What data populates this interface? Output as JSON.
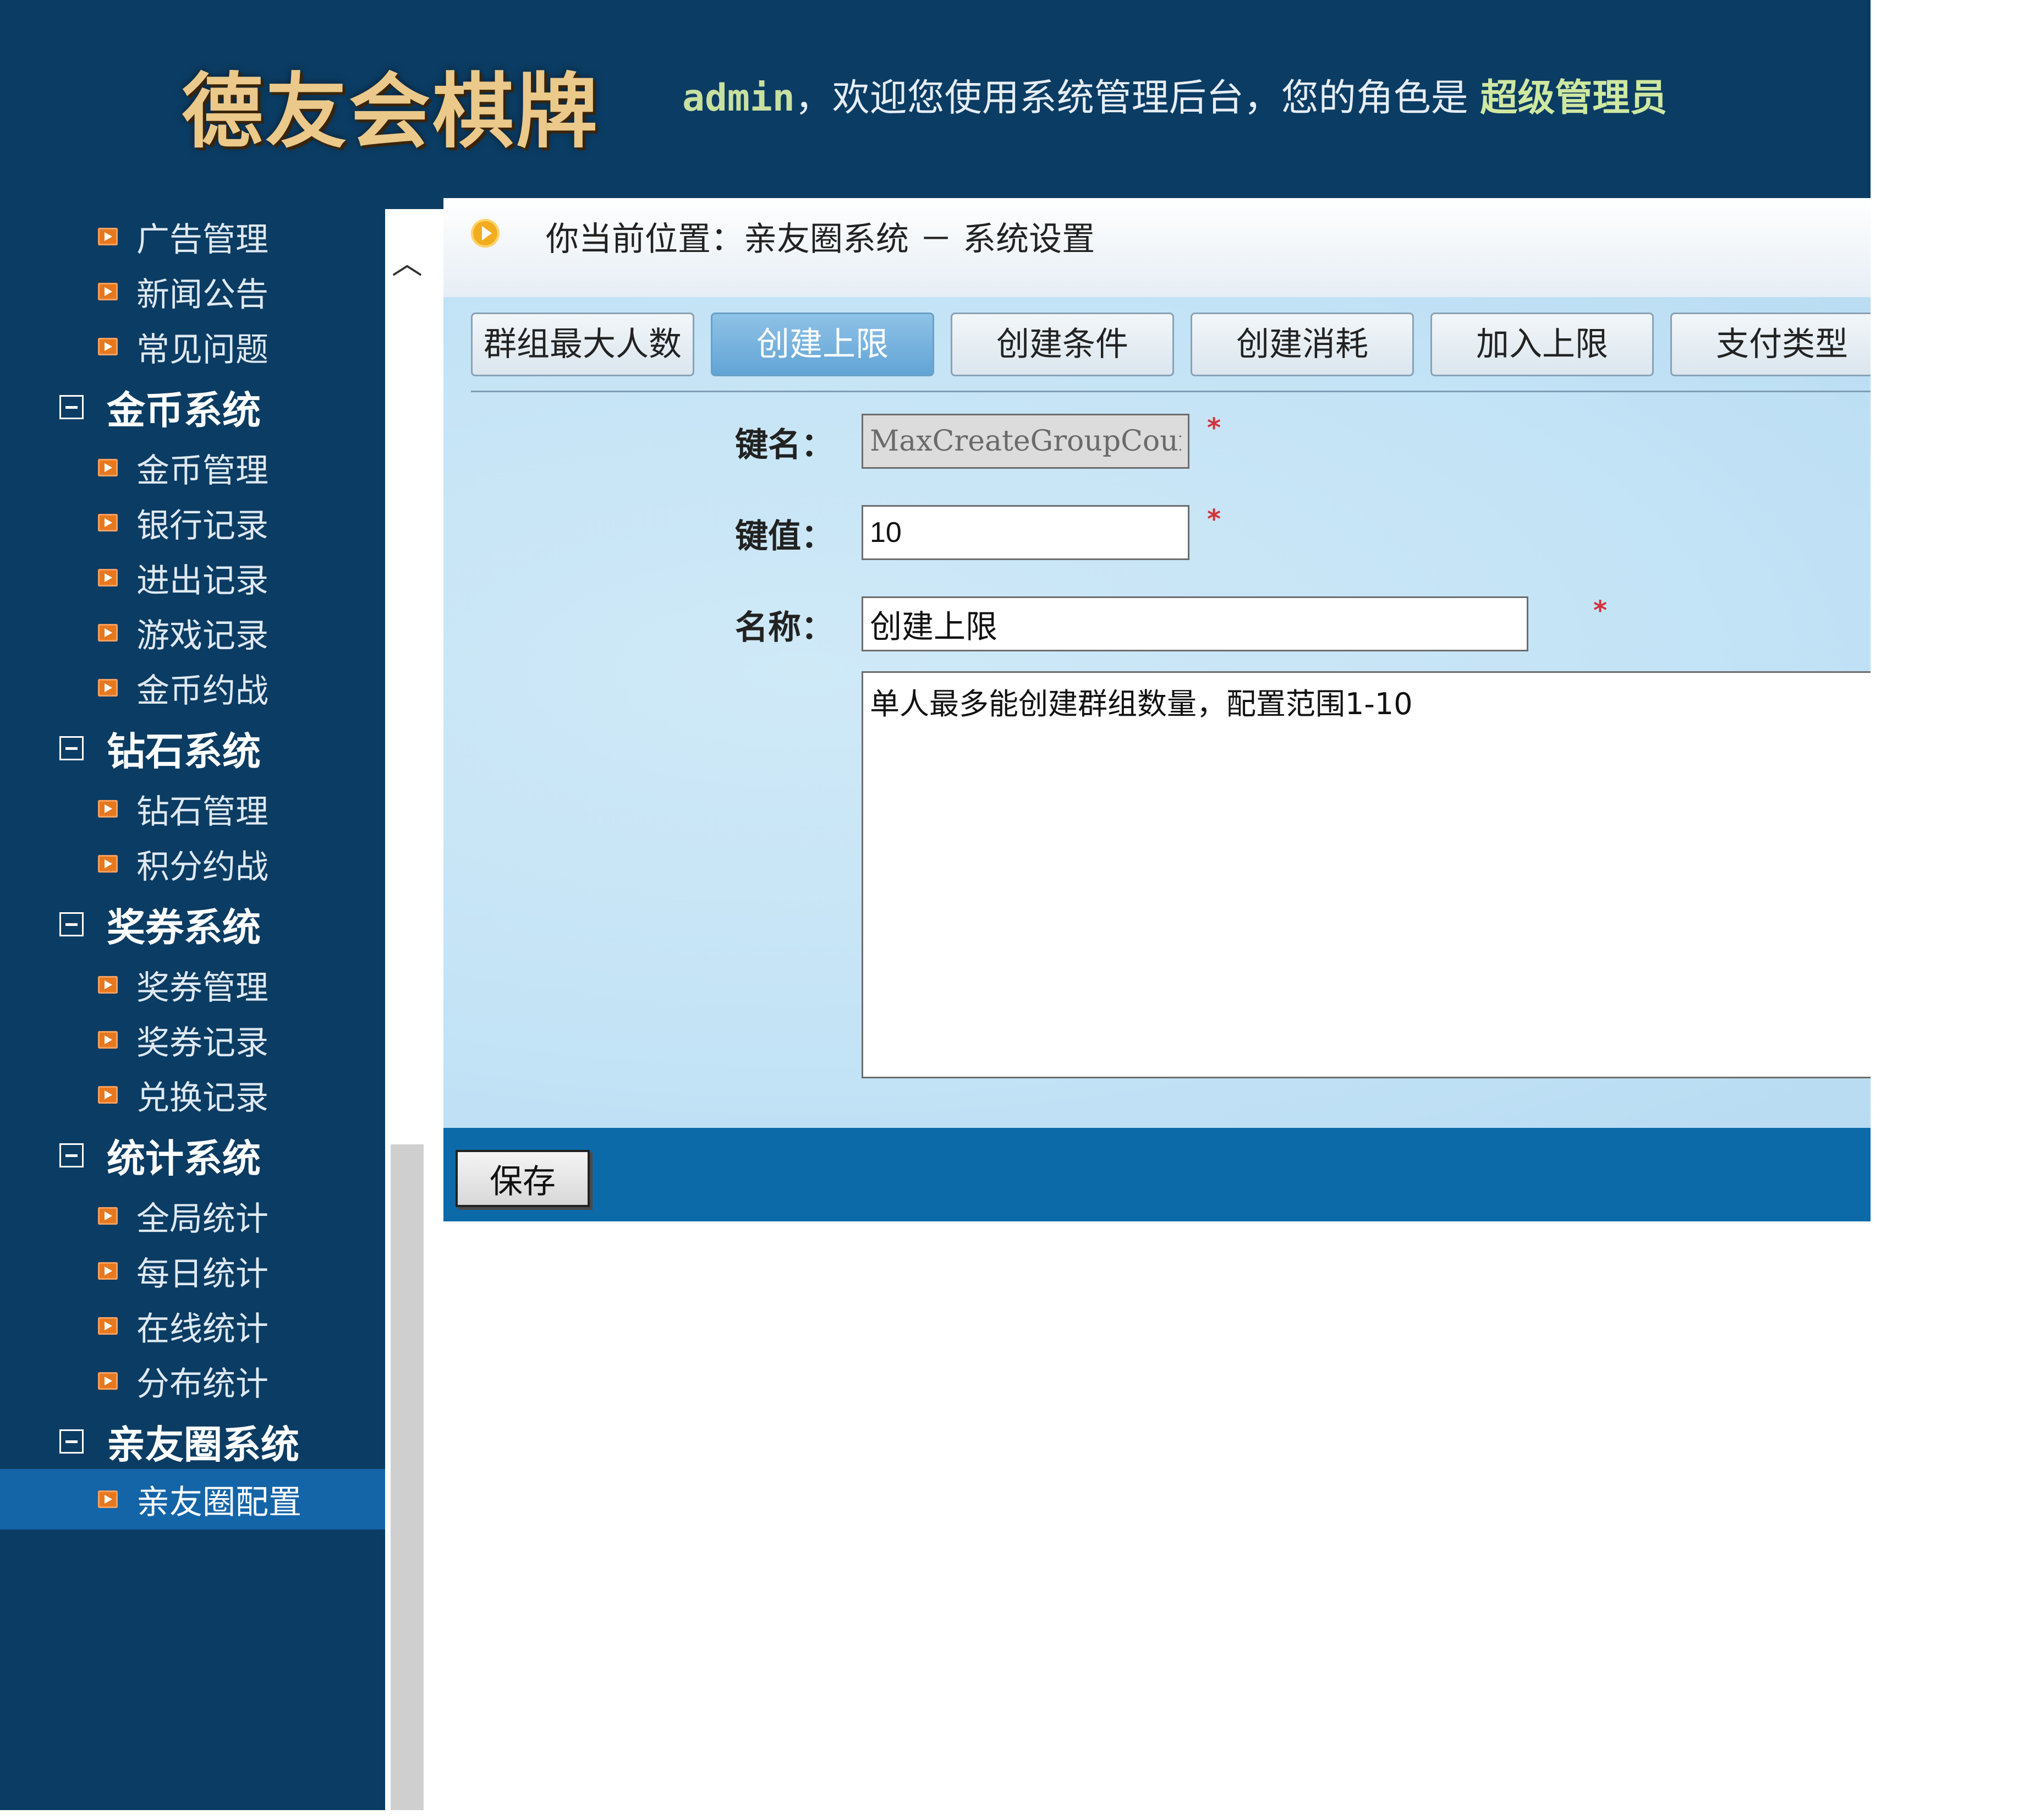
{
  "header": {
    "logo": "德友会棋牌",
    "user": "admin",
    "welcome_text": "，欢迎您使用系统管理后台，您的角色是",
    "role": "超级管理员"
  },
  "sidebar": {
    "cutoff_text": "…",
    "items": [
      {
        "type": "item",
        "label": "广告管理"
      },
      {
        "type": "item",
        "label": "新闻公告"
      },
      {
        "type": "item",
        "label": "常见问题"
      },
      {
        "type": "group",
        "label": "金币系统"
      },
      {
        "type": "item",
        "label": "金币管理"
      },
      {
        "type": "item",
        "label": "银行记录"
      },
      {
        "type": "item",
        "label": "进出记录"
      },
      {
        "type": "item",
        "label": "游戏记录"
      },
      {
        "type": "item",
        "label": "金币约战"
      },
      {
        "type": "group",
        "label": "钻石系统"
      },
      {
        "type": "item",
        "label": "钻石管理"
      },
      {
        "type": "item",
        "label": "积分约战"
      },
      {
        "type": "group",
        "label": "奖券系统"
      },
      {
        "type": "item",
        "label": "奖券管理"
      },
      {
        "type": "item",
        "label": "奖券记录"
      },
      {
        "type": "item",
        "label": "兑换记录"
      },
      {
        "type": "group",
        "label": "统计系统"
      },
      {
        "type": "item",
        "label": "全局统计"
      },
      {
        "type": "item",
        "label": "每日统计"
      },
      {
        "type": "item",
        "label": "在线统计"
      },
      {
        "type": "item",
        "label": "分布统计"
      },
      {
        "type": "group",
        "label": "亲友圈系统"
      },
      {
        "type": "item",
        "label": "亲友圈配置",
        "selected": true
      }
    ]
  },
  "breadcrumb": "你当前位置：亲友圈系统 － 系统设置",
  "tabs": [
    {
      "label": "群组最大人数"
    },
    {
      "label": "创建上限",
      "active": true
    },
    {
      "label": "创建条件"
    },
    {
      "label": "创建消耗"
    },
    {
      "label": "加入上限"
    },
    {
      "label": "支付类型"
    }
  ],
  "form": {
    "key_label": "键名：",
    "key_value": "MaxCreateGroupCount",
    "value_label": "键值：",
    "value_value": "10",
    "name_label": "名称：",
    "name_value": "创建上限",
    "required_mark": "*",
    "description": "单人最多能创建群组数量，配置范围1-10"
  },
  "actions": {
    "save_label": "保存"
  },
  "colors": {
    "sidebar_bg": "#0b3c63",
    "selected_item": "#1464a8",
    "active_tab": "#62a4d6",
    "action_bar": "#0d6aa8",
    "required": "#d0343a"
  }
}
